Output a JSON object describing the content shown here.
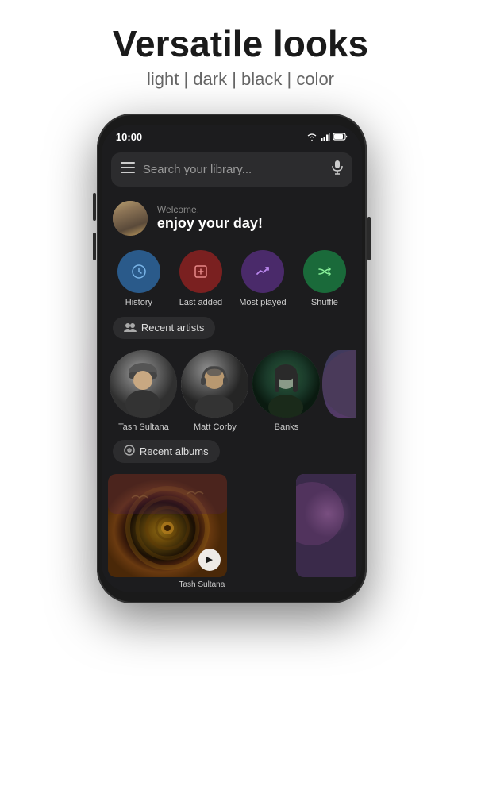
{
  "header": {
    "title": "Versatile looks",
    "subtitle": "light | dark | black | color"
  },
  "status_bar": {
    "time": "10:00",
    "icons": "▼ LTE ○"
  },
  "search": {
    "placeholder": "Search your library..."
  },
  "welcome": {
    "greeting": "Welcome,",
    "message": "enjoy your day!"
  },
  "quick_actions": [
    {
      "id": "history",
      "label": "History",
      "icon": "🕐",
      "color": "history-color"
    },
    {
      "id": "last-added",
      "label": "Last added",
      "icon": "⊞",
      "color": "lastadded-color"
    },
    {
      "id": "most-played",
      "label": "Most played",
      "icon": "↗",
      "color": "mostplayed-color"
    },
    {
      "id": "shuffle",
      "label": "Shuffle",
      "icon": "⇌",
      "color": "shuffle-color"
    }
  ],
  "recent_artists": {
    "chip_label": "Recent artists",
    "artists": [
      {
        "name": "Tash Sultana",
        "color": "artist-tash"
      },
      {
        "name": "Matt Corby",
        "color": "artist-matt"
      },
      {
        "name": "Banks",
        "color": "artist-banks"
      }
    ]
  },
  "recent_albums": {
    "chip_label": "Recent albums",
    "albums": [
      {
        "name": "Tash Sultana",
        "type": "spiral"
      },
      {
        "name": "...",
        "type": "partial"
      }
    ]
  }
}
